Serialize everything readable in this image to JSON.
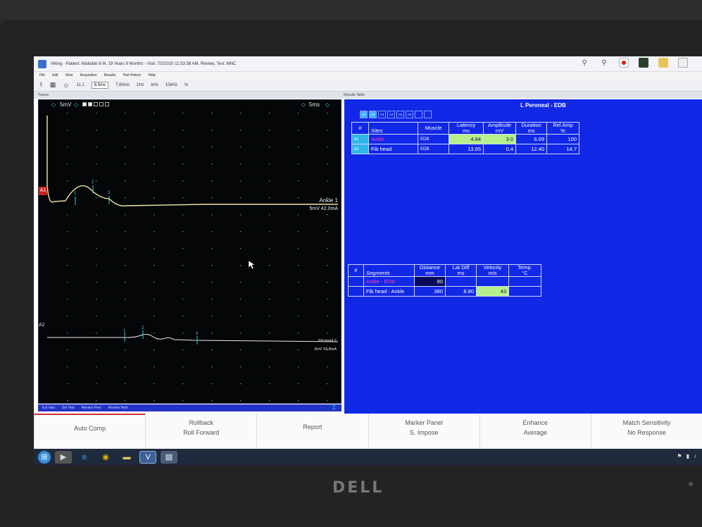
{
  "window": {
    "title": "Viking - Patient: Abdullah 6 M, 19 Years 9 Months - Visit: 7/2/2020 11:53:38 AM, Review, Test: MNC",
    "menu": [
      "File",
      "Edit",
      "View",
      "Acquisition",
      "Results",
      "Test History",
      "Help"
    ]
  },
  "toolbar": {
    "sweep_value": "8.5ms",
    "channel": "11.1",
    "text_a": "7.60ms",
    "text_b": "1Hz",
    "text_c": "kHz",
    "text_d": "10kHz",
    "text_e": "%"
  },
  "subheader": {
    "left": "Traces",
    "right": "Results Table"
  },
  "waveform": {
    "sensitivity": "5mV",
    "sweep": "5ms",
    "diamond": "◇",
    "trace_a1_label": "A1",
    "trace_a2_label": "A2",
    "trace1": {
      "name": "Ankle 1",
      "meta": "5mV 42.0mA",
      "markers": [
        "1",
        "2",
        "3"
      ]
    },
    "trace2": {
      "name": "Fib head 2",
      "meta": "2mV 43.8mA",
      "markers": [
        "1",
        "2",
        "3"
      ]
    },
    "colors": {
      "trace": "#f1e6a8",
      "marker": "#35d0d8",
      "grid_dot": "#2fc7c7"
    },
    "tabs": [
      "Ext Vals",
      "Sel Test",
      "Review Prev",
      "Review Next"
    ],
    "sigma_icon": "Σ"
  },
  "results": {
    "title": "L Peroneal - EDB",
    "mode_tabs": [
      "A1",
      "A2",
      "A3",
      "A4",
      "A5",
      "A6",
      "",
      ""
    ],
    "sites_table": {
      "headers": [
        "#",
        "Sites",
        "Muscle",
        "Latency\nms",
        "Amplitude\nmV",
        "Duration\nms",
        "Rel Amp\n%"
      ],
      "rows": [
        {
          "idx": "A1",
          "site": "Ankle",
          "muscle": "EDB",
          "latency": "4.84",
          "amplitude": "3.0",
          "duration": "6.09",
          "rel_amp": "100"
        },
        {
          "idx": "A2",
          "site": "Fib head",
          "muscle": "EDB",
          "latency": "13.65",
          "amplitude": "0.4",
          "duration": "12.40",
          "rel_amp": "14.7"
        }
      ]
    },
    "segments_table": {
      "headers": [
        "#",
        "Segments",
        "Distance\nmm",
        "Lat Diff\nms",
        "Velocity\nm/s",
        "Temp.\n°C"
      ],
      "rows": [
        {
          "segment": "Ankle - EDB",
          "distance": "80",
          "lat_diff": "",
          "velocity": "",
          "temp": ""
        },
        {
          "segment": "Fib head - Ankle",
          "distance": "380",
          "lat_diff": "8.80",
          "velocity": "43",
          "temp": ""
        }
      ]
    }
  },
  "fkeys": [
    {
      "l1": "Auto Comp",
      "l2": ""
    },
    {
      "l1": "Rollback",
      "l2": "Roll Forward"
    },
    {
      "l1": "Report",
      "l2": ""
    },
    {
      "l1": "Marker Panel",
      "l2": "S. Impose"
    },
    {
      "l1": "Enhance",
      "l2": "Average"
    },
    {
      "l1": "Match Sensitivity",
      "l2": "No Response"
    }
  ],
  "bezel": {
    "brand": "DELL"
  }
}
